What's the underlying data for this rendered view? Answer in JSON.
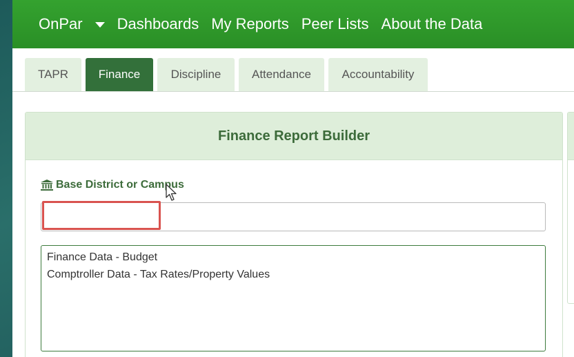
{
  "nav": {
    "brand": "OnPar",
    "links": [
      "Dashboards",
      "My Reports",
      "Peer Lists",
      "About the Data"
    ]
  },
  "tabs": [
    {
      "label": "TAPR",
      "active": false
    },
    {
      "label": "Finance",
      "active": true
    },
    {
      "label": "Discipline",
      "active": false
    },
    {
      "label": "Attendance",
      "active": false
    },
    {
      "label": "Accountability",
      "active": false
    }
  ],
  "panel": {
    "title": "Finance Report Builder",
    "field_label": "Base District or Campus",
    "field_icon": "bank-icon",
    "input_value": "",
    "options": [
      "Finance Data - Budget",
      "Comptroller Data - Tax Rates/Property Values"
    ]
  },
  "colors": {
    "navbar": "#2e9a2a",
    "active_tab": "#33703a",
    "tab": "#e3f0e0",
    "panel_header": "#deeeda",
    "highlight": "#d9534f"
  }
}
